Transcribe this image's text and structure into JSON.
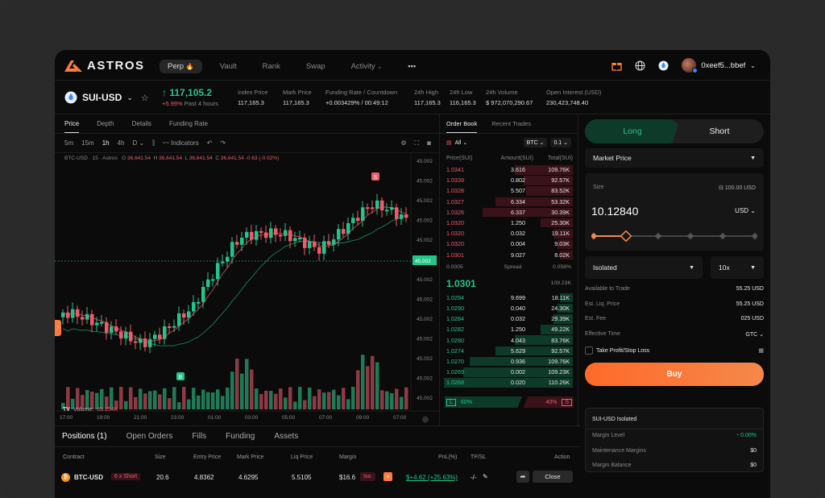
{
  "app": {
    "brand": "ASTROS"
  },
  "nav": {
    "links": [
      "Perp",
      "Vault",
      "Rank",
      "Swap",
      "Activity"
    ],
    "account": "0xeef5...bbef"
  },
  "ticker": {
    "pair": "SUI-USD",
    "price": "117,105.2",
    "change": "+5.99%",
    "change_period": "Past 4 hours",
    "stats": [
      {
        "label": "Index Price",
        "value": "117,165.3"
      },
      {
        "label": "Mark Price",
        "value": "117,165.3"
      },
      {
        "label": "Funding Rate / Countdown",
        "value": "+0.003429% / 00:49:12"
      },
      {
        "label": "24h High",
        "value": "117,165.3"
      },
      {
        "label": "24h Low",
        "value": "116,165.3"
      },
      {
        "label": "24h Volume",
        "value": "$ 972,070,290.67"
      },
      {
        "label": "Open Interest (USD)",
        "value": "230,423,748.40"
      }
    ]
  },
  "chart_tabs": [
    "Price",
    "Depth",
    "Details",
    "Funding Rate"
  ],
  "chart_toolbar": {
    "intervals": [
      "5m",
      "15m",
      "1h",
      "4h",
      "D"
    ],
    "indicators": "Indicators"
  },
  "chart_legend": {
    "symbol": "BTC-USD · 15 · Astros",
    "o_label": "O",
    "o": "36,641.54",
    "h_label": "H",
    "h": "36,641.54",
    "l_label": "L",
    "l": "36,641.54",
    "c_label": "C",
    "c": "36,641.54 -0.63 (-0.02%)"
  },
  "volume_label": {
    "label": "Volume:",
    "value": "65.254K"
  },
  "chart_data": {
    "type": "candlestick",
    "y_axis_ticks": [
      "45.002",
      "45.002",
      "45.002",
      "45.002",
      "45.002",
      "45.002",
      "45.002",
      "45.002",
      "45.002",
      "45.002",
      "45.002",
      "45.002",
      "45.002"
    ],
    "current_price_label": "45.002",
    "x_ticks": [
      "17:00",
      "19:00",
      "21:00",
      "23:00",
      "01:00",
      "03:00",
      "05:00",
      "07:00",
      "09:00",
      "07:00"
    ],
    "markers": [
      "S",
      "B"
    ]
  },
  "orderbook": {
    "tabs": [
      "Order Book",
      "Recent Trades"
    ],
    "filter": "All",
    "unit": "BTC",
    "precision": "0.1",
    "headers": [
      "Price(SUI)",
      "Amount(SUI)",
      "Total(SUI)"
    ],
    "asks": [
      [
        "1.0341",
        "3.616",
        "109.76K"
      ],
      [
        "1.0339",
        "0.802",
        "92.57K"
      ],
      [
        "1.0328",
        "5.507",
        "83.52K"
      ],
      [
        "1.0327",
        "6.334",
        "53.32K"
      ],
      [
        "1.0326",
        "6.337",
        "30.39K"
      ],
      [
        "1.0320",
        "1.250",
        "25.30K"
      ],
      [
        "1.0320",
        "0.032",
        "19.11K"
      ],
      [
        "1.0320",
        "0.004",
        "9.03K"
      ],
      [
        "1.0301",
        "9.027",
        "8.02K"
      ]
    ],
    "ask_fill": [
      0.45,
      0.38,
      0.36,
      0.6,
      0.7,
      0.25,
      0.15,
      0.12,
      0.1
    ],
    "spread_price": "0.0005",
    "spread_label": "Spread",
    "spread_pct": "0.058%",
    "mid_price": "1.0301",
    "mid_total": "109.23K",
    "bids": [
      [
        "1.0294",
        "9.699",
        "18.11K"
      ],
      [
        "1.0290",
        "0.040",
        "24.30K"
      ],
      [
        "1.0284",
        "0.032",
        "29.39K"
      ],
      [
        "1.0282",
        "1.250",
        "49.22K"
      ],
      [
        "1.0280",
        "4.043",
        "83.76K"
      ],
      [
        "1.0274",
        "5.629",
        "92.57K"
      ],
      [
        "1.0270",
        "0.936",
        "109.76K"
      ],
      [
        "1.0269",
        "0.002",
        "109.23K"
      ],
      [
        "1.0268",
        "0.020",
        "110.26K"
      ]
    ],
    "bid_fill": [
      0.1,
      0.12,
      0.15,
      0.25,
      0.45,
      0.6,
      0.8,
      0.85,
      1.0
    ],
    "buy_pct": "60%",
    "sell_pct": "40%",
    "buy_letter": "L",
    "sell_letter": "S",
    "buy_ratio": 0.6
  },
  "trade": {
    "long": "Long",
    "short": "Short",
    "order_type": "Market Price",
    "size_label": "Size",
    "size_avail": "100.00 USD",
    "size_value": "10.12840",
    "size_unit": "USD",
    "slider_level": 0.2,
    "margin_mode": "Isolated",
    "leverage": "10x",
    "info": [
      {
        "label": "Available to Trade",
        "value": "55.25 USD"
      },
      {
        "label": "Est. Liq. Price",
        "value": "55.25 USD"
      },
      {
        "label": "Est. Fee",
        "value": "025 USD"
      },
      {
        "label": "Effective Time",
        "value": "GTC"
      }
    ],
    "tpsl": "Take Profit/Stop Loss",
    "buy": "Buy",
    "iso_title": "SUI-USD Isolated",
    "iso_rows": [
      {
        "label": "Margin Level",
        "value": "0.00%"
      },
      {
        "label": "Maintenance Margins",
        "value": "$0"
      },
      {
        "label": "Margin Balance",
        "value": "$0"
      }
    ]
  },
  "positions": {
    "tabs": [
      "Positions (1)",
      "Open Orders",
      "Fills",
      "Funding",
      "Assets"
    ],
    "headers": [
      "Contract",
      "Size",
      "Entry Price",
      "Mark Price",
      "Liq Price",
      "Margin",
      "PnL(%)",
      "TP/SL",
      "Action"
    ],
    "row": {
      "contract": "BTC-USD",
      "tag": "6 x Short",
      "size": "20.6",
      "entry": "4.8362",
      "mark": "4.6295",
      "liq": "5.5105",
      "margin": "$16.6",
      "iso": "Iso.",
      "plus": "+",
      "pnl": "$+4.62 (+25.63%)",
      "tpsl": "-/-",
      "close": "Close"
    }
  },
  "colors": {
    "green": "#22c58b",
    "red": "#f05a6a",
    "orange": "#ff7a3d",
    "buy_bar": "#f4884a"
  }
}
